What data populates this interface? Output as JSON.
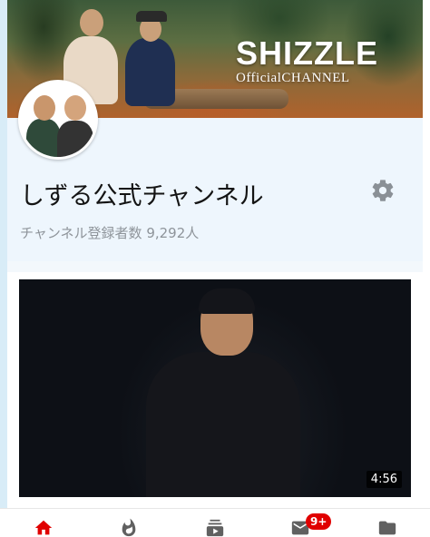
{
  "banner": {
    "title": "SHIZZLE",
    "subtitle": "OfficialCHANNEL"
  },
  "channel": {
    "name": "しずる公式チャンネル",
    "subscribers": "チャンネル登録者数 9,292人"
  },
  "video": {
    "duration": "4:56"
  },
  "bottom_nav": {
    "items": [
      {
        "icon": "home-icon",
        "active": true
      },
      {
        "icon": "trending-icon",
        "active": false
      },
      {
        "icon": "subscriptions-icon",
        "active": false
      },
      {
        "icon": "inbox-icon",
        "active": false,
        "badge": "9+"
      },
      {
        "icon": "library-icon",
        "active": false
      }
    ]
  },
  "colors": {
    "accent": "#e00000",
    "icon_gray": "#606060",
    "channel_bg": "#eef6fd"
  }
}
